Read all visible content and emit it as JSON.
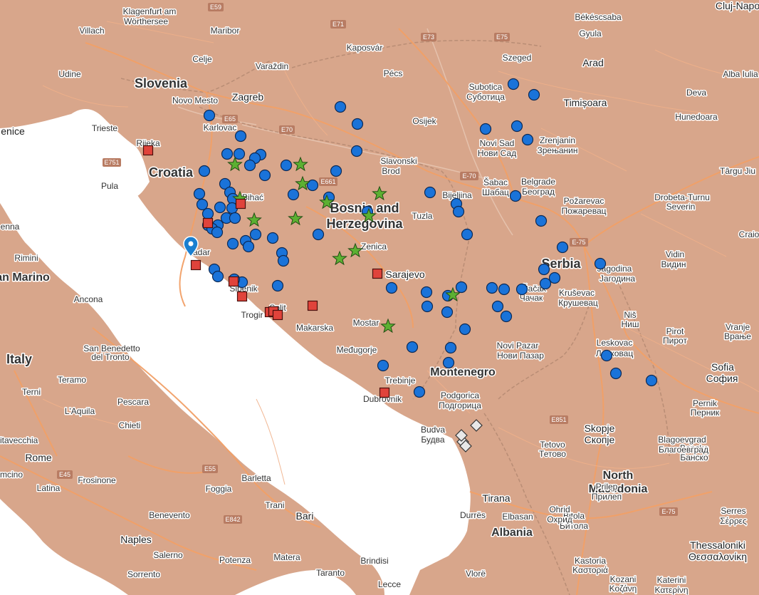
{
  "map": {
    "country_labels": [
      {
        "id": "slovenia",
        "text": "Slovenia"
      },
      {
        "id": "croatia",
        "text": "Croatia"
      },
      {
        "id": "bosnia-1",
        "text": "Bosnia and"
      },
      {
        "id": "bosnia-2",
        "text": "Herzegovina"
      },
      {
        "id": "serbia",
        "text": "Serbia"
      },
      {
        "id": "montenegro",
        "text": "Montenegro"
      },
      {
        "id": "north-macedonia-1",
        "text": "North"
      },
      {
        "id": "north-macedonia-2",
        "text": "Macedonia"
      },
      {
        "id": "albania",
        "text": "Albania"
      },
      {
        "id": "italy",
        "text": "Italy"
      },
      {
        "id": "san-marino",
        "text": "an Marino"
      }
    ],
    "city_labels": [
      "Klagenfurt am",
      "Wörthersee",
      "Villach",
      "Maribor",
      "Celje",
      "Varaždin",
      "Zagreb",
      "Novo Mesto",
      "Karlovac",
      "Udine",
      "Trieste",
      "enice",
      "Rijeka",
      "Pula",
      "Kaposvár",
      "Pécs",
      "Szeged",
      "Subotica",
      "Суботица",
      "Arad",
      "Békéscsaba",
      "Gyula",
      "Deva",
      "Hunedoara",
      "Timișoara",
      "Osijek",
      "Novi Sad",
      "Нови Сад",
      "Zrenjanin",
      "Зрењанин",
      "Slavonski",
      "Brod",
      "Bihać",
      "Bijeljina",
      "Šabac",
      "Шабац",
      "Belgrade",
      "Београд",
      "Požarevac",
      "Пожаревац",
      "Tuzla",
      "Zenica",
      "Sarajevo",
      "Mostar",
      "Međugorje",
      "Makarska",
      "Split",
      "Trogir",
      "Šibenik",
      "adar",
      "Trebinje",
      "Dubrovnik",
      "Podgorica",
      "Подгорица",
      "Budva",
      "Будва",
      "Novi Pazar",
      "Нови Пазар",
      "Čačak",
      "Чачак",
      "Kruševac",
      "Крушевац",
      "Jagodina",
      "Јагодина",
      "Niš",
      "Ниш",
      "Pirot",
      "Пирот",
      "Vranje",
      "Врање",
      "Leskovac",
      "Лесковац",
      "Sofia",
      "София",
      "Pernik",
      "Перник",
      "Vidin",
      "Видин",
      "Drobeta-Turnu",
      "Severin",
      "Târgu Jiu",
      "Craio",
      "Cluj-Napo",
      "Alba Iulia",
      "Skopje",
      "Скопје",
      "Tetovo",
      "Тетово",
      "Prilep",
      "Прилеп",
      "Bitola",
      "Битола",
      "Ohrid",
      "Охрид",
      "Bansko",
      "Банско",
      "Blagoevgrad",
      "Благоевград",
      "Serres",
      "Σέρρες",
      "Thessaloniki",
      "Θεσσαλονίκη",
      "Kastoria",
      "Καστοριά",
      "Kozani",
      "Κοζάνη",
      "Katerini",
      "Κατερίνη",
      "Tirana",
      "Durrës",
      "Elbasan",
      "Vlorë",
      "Ancona",
      "Rimini",
      "San Benedetto",
      "del Tronto",
      "Pescara",
      "Chieti",
      "Teramo",
      "Terni",
      "L'Aquila",
      "Rome",
      "Latina",
      "Frosinone",
      "Foggia",
      "Barletta",
      "Trani",
      "Bari",
      "Matera",
      "Potenza",
      "Benevento",
      "Naples",
      "Salerno",
      "Sorrento",
      "Brindisi",
      "Taranto",
      "Lecce",
      "Civitavecchia",
      "enna",
      "mcino"
    ],
    "road_labels": [
      "E59",
      "E71",
      "E73",
      "E75",
      "E65",
      "E70",
      "E751",
      "E661",
      "E-70",
      "E-75",
      "E851",
      "E45",
      "E55",
      "E842",
      "E-75"
    ],
    "legend_colors": {
      "circle": "#1a73d9",
      "star": "#5cb032",
      "square": "#e0433b",
      "diamond": "#e8e8e8",
      "pin": "#1a7fd0",
      "land": "#d6a68a",
      "sea": "#ffffff",
      "road": "#f3a36b"
    },
    "markers": {
      "circles_count": 119,
      "stars_count": 14,
      "squares_count": 15,
      "diamonds_count": 4,
      "pin_icon": "map-pin-icon"
    }
  }
}
